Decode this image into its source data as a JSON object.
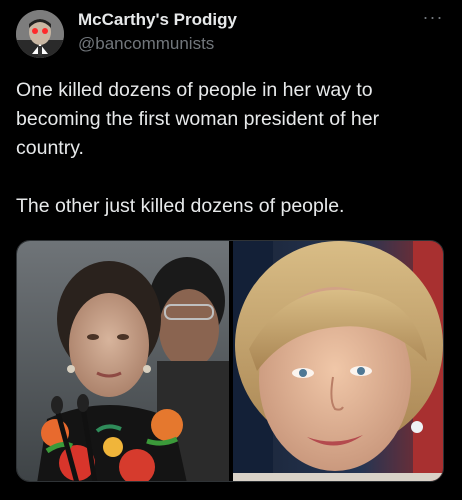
{
  "post": {
    "author": {
      "display_name": "McCarthy's Prodigy",
      "handle": "@bancommunists",
      "avatar_icon": "user-avatar-icon"
    },
    "more_icon": "more-horizontal-icon",
    "more_label": "···",
    "text": {
      "line1": "One killed dozens of people in her way to becoming the first woman president of her country.",
      "line2": "The other just killed dozens of people."
    },
    "media": {
      "type": "photo-collage",
      "panels": 2
    }
  },
  "colors": {
    "background": "#000000",
    "primary_text": "#e7e9ea",
    "secondary_text": "#71767b",
    "border": "#2f3336"
  }
}
